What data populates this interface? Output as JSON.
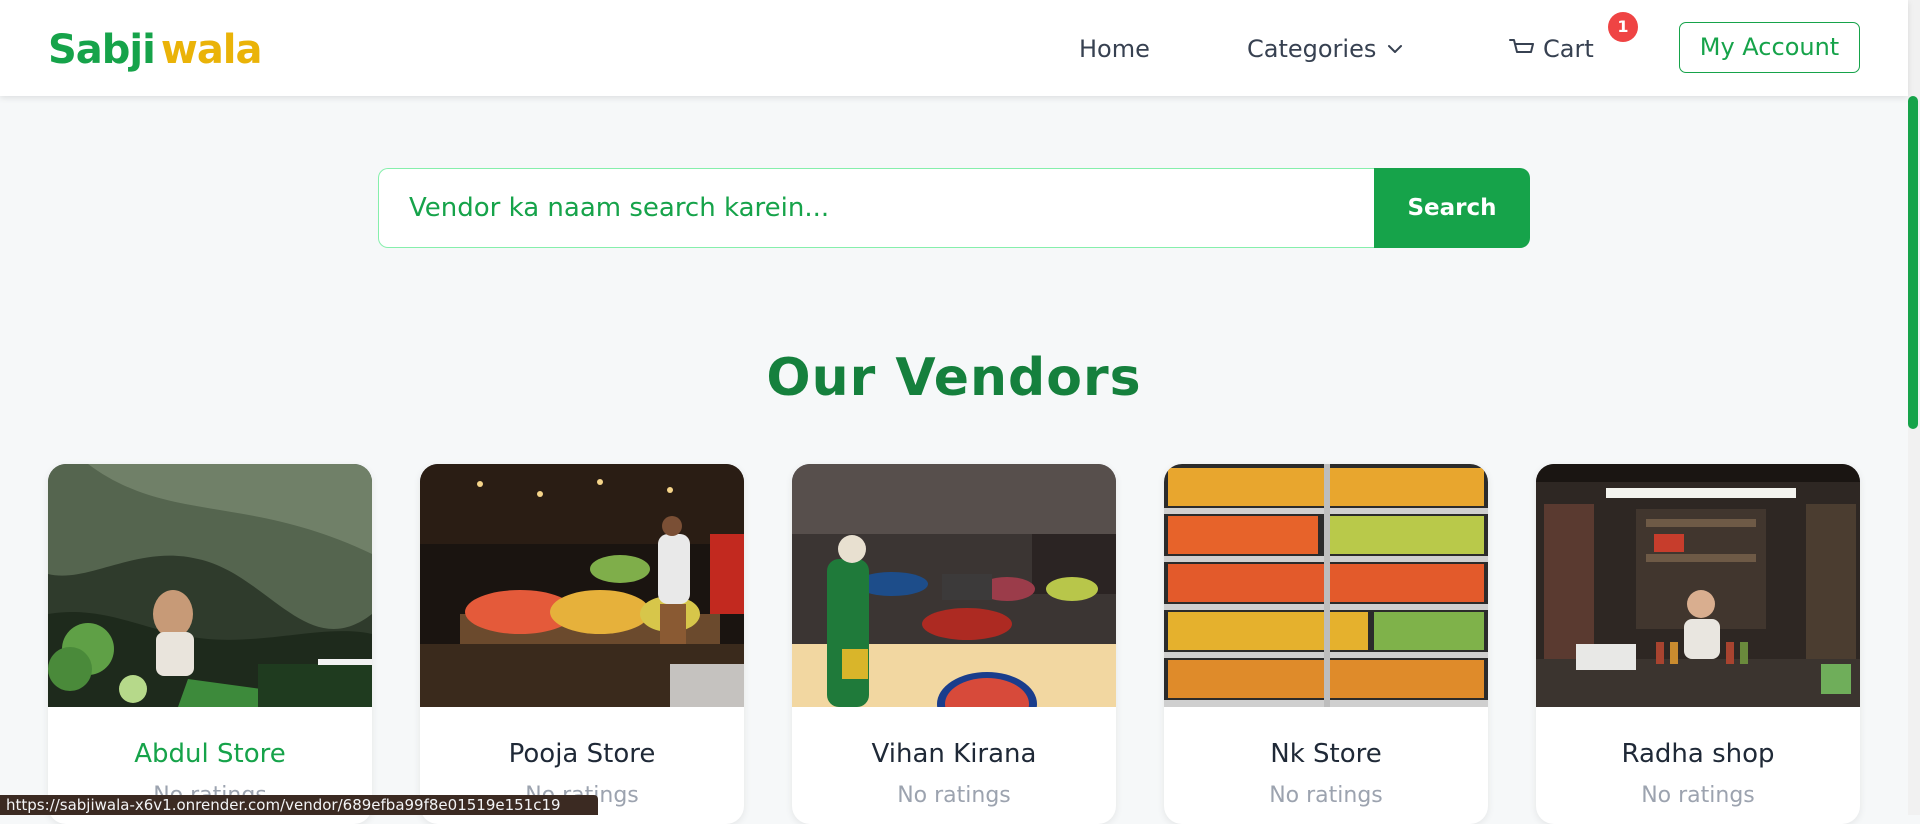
{
  "brand": {
    "part1": "Sabji",
    "part2": "wala"
  },
  "nav": {
    "home": "Home",
    "categories": "Categories",
    "cart": "Cart",
    "cart_count": "1",
    "account": "My Account"
  },
  "search": {
    "placeholder": "Vendor ka naam search karein...",
    "value": "",
    "button": "Search"
  },
  "section_title": "Our Vendors",
  "vendors": [
    {
      "name": "Abdul Store",
      "rating": "No ratings",
      "image": "vegetable-stall-photo"
    },
    {
      "name": "Pooja Store",
      "rating": "No ratings",
      "image": "fruit-market-photo"
    },
    {
      "name": "Vihan Kirana",
      "rating": "No ratings",
      "image": "market-counter-photo"
    },
    {
      "name": "Nk Store",
      "rating": "No ratings",
      "image": "snack-shelves-photo"
    },
    {
      "name": "Radha shop",
      "rating": "No ratings",
      "image": "shop-interior-photo"
    }
  ],
  "status_url": "https://sabjiwala-x6v1.onrender.com/vendor/689efba99f8e01519e151c19",
  "colors": {
    "brand_green": "#16a34a",
    "brand_yellow": "#eab308",
    "badge_red": "#ef4444",
    "title_green": "#15803d"
  }
}
